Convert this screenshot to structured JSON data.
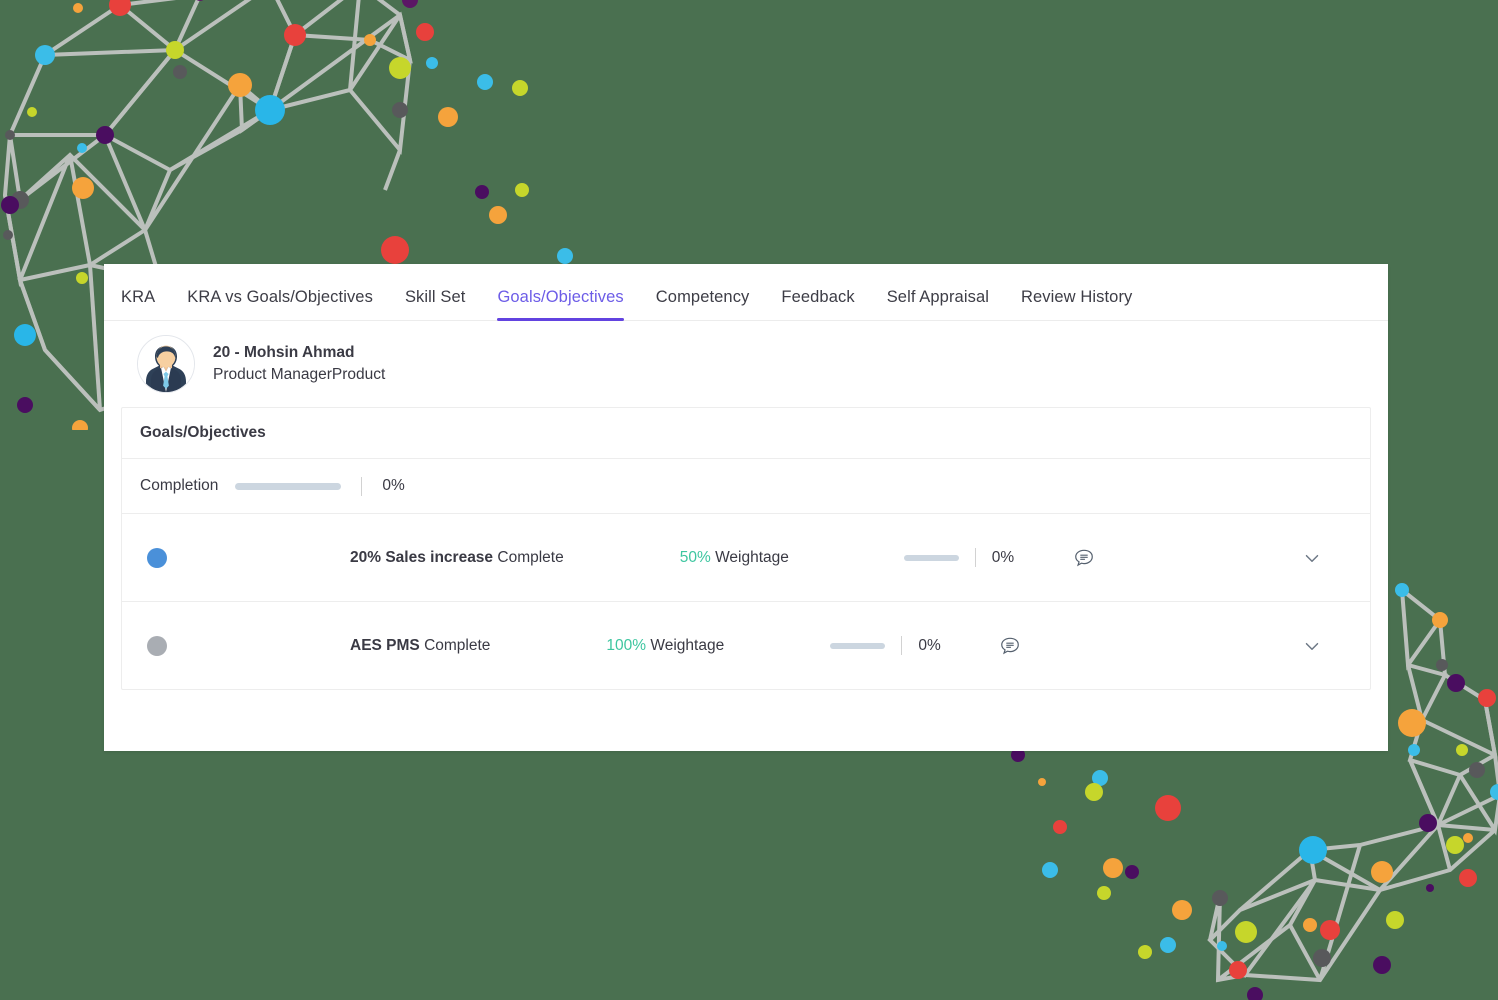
{
  "theme": {
    "background": "#4a7050",
    "card_background": "#ffffff",
    "accent": "#6c5ce7",
    "accent_underline": "#6243e0",
    "weightage_color": "#3ec6a0",
    "text_color": "#3a3a44",
    "progress_track": "#ccd6e0"
  },
  "tabs": [
    {
      "label": "KRA",
      "active": false
    },
    {
      "label": "KRA vs Goals/Objectives",
      "active": false
    },
    {
      "label": "Skill Set",
      "active": false
    },
    {
      "label": "Goals/Objectives",
      "active": true
    },
    {
      "label": "Competency",
      "active": false
    },
    {
      "label": "Feedback",
      "active": false
    },
    {
      "label": "Self Appraisal",
      "active": false
    },
    {
      "label": "Review History",
      "active": false
    }
  ],
  "employee": {
    "avatar_icon": "user-avatar-icon",
    "name": "20 - Mohsin Ahmad",
    "role": "Product ManagerProduct"
  },
  "panel": {
    "title": "Goals/Objectives",
    "completion": {
      "label": "Completion",
      "percent": "0%",
      "progress_value": 0
    }
  },
  "goals": [
    {
      "status_color": "#4a90d9",
      "status_icon": "status-dot-icon",
      "title": "20% Sales increase",
      "state": "Complete",
      "weightage_value": "50%",
      "weightage_label": "Weightage",
      "progress_percent": "0%",
      "progress_value": 0,
      "comment_icon": "comment-bubble-icon",
      "expand_icon": "chevron-down-icon"
    },
    {
      "status_color": "#a9adb3",
      "status_icon": "status-dot-icon",
      "title": "AES PMS",
      "state": "Complete",
      "weightage_value": "100%",
      "weightage_label": "Weightage",
      "progress_percent": "0%",
      "progress_value": 0,
      "comment_icon": "comment-bubble-icon",
      "expand_icon": "chevron-down-icon"
    }
  ]
}
